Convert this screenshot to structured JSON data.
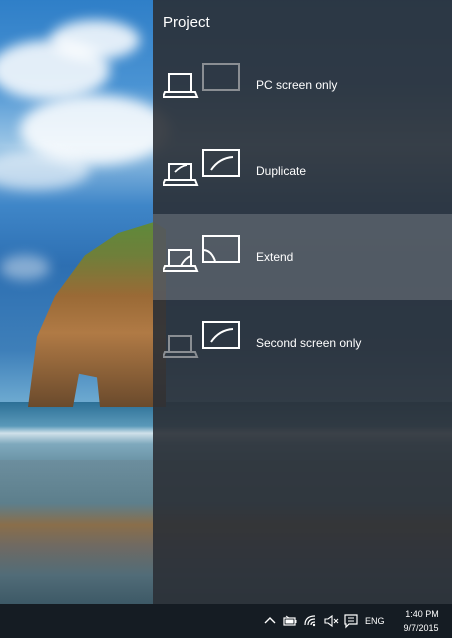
{
  "flyout": {
    "title": "Project",
    "options": [
      {
        "label": "PC screen only",
        "icon": "pc-screen-only-icon",
        "selected": false
      },
      {
        "label": "Duplicate",
        "icon": "duplicate-icon",
        "selected": false
      },
      {
        "label": "Extend",
        "icon": "extend-icon",
        "selected": true
      },
      {
        "label": "Second screen only",
        "icon": "second-screen-only-icon",
        "selected": false
      }
    ]
  },
  "taskbar": {
    "tray_icons": [
      "chevron-up-icon",
      "battery-icon",
      "wifi-icon",
      "volume-muted-icon",
      "action-center-icon"
    ],
    "language": "ENG",
    "time": "1:40 PM",
    "date": "9/7/2015"
  },
  "colors": {
    "panel_bg": "#2b3036",
    "selected_bg": "#5a5e63",
    "taskbar_bg": "#151c23",
    "icon_dim": "#8a8e93",
    "text": "#ffffff"
  }
}
